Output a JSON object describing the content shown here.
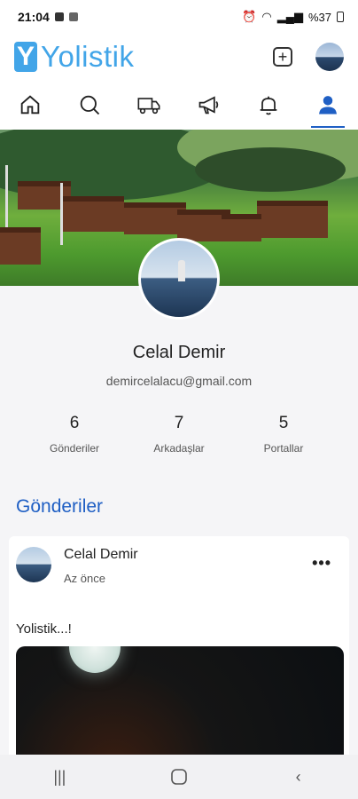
{
  "status_bar": {
    "time": "21:04",
    "battery": "%37"
  },
  "header": {
    "brand": "Yolistik",
    "logo_letter": "Y",
    "add_icon": "plus-square-icon"
  },
  "tabs": [
    {
      "icon": "home-icon",
      "active": false
    },
    {
      "icon": "search-icon",
      "active": false
    },
    {
      "icon": "truck-icon",
      "active": false
    },
    {
      "icon": "megaphone-icon",
      "active": false
    },
    {
      "icon": "bell-icon",
      "active": false
    },
    {
      "icon": "user-icon",
      "active": true
    }
  ],
  "profile": {
    "name": "Celal Demir",
    "email": "demircelalacu@gmail.com",
    "stats": [
      {
        "value": "6",
        "label": "Gönderiler"
      },
      {
        "value": "7",
        "label": "Arkadaşlar"
      },
      {
        "value": "5",
        "label": "Portallar"
      }
    ]
  },
  "posts_section": {
    "title": "Gönderiler",
    "posts": [
      {
        "author": "Celal Demir",
        "time": "Az önce",
        "text": "Yolistik...!",
        "menu": "•••"
      }
    ]
  },
  "colors": {
    "brand": "#42a5e8",
    "accent": "#1f5fc4"
  },
  "system_nav": [
    "recent-apps-icon",
    "home-button-icon",
    "back-icon"
  ]
}
